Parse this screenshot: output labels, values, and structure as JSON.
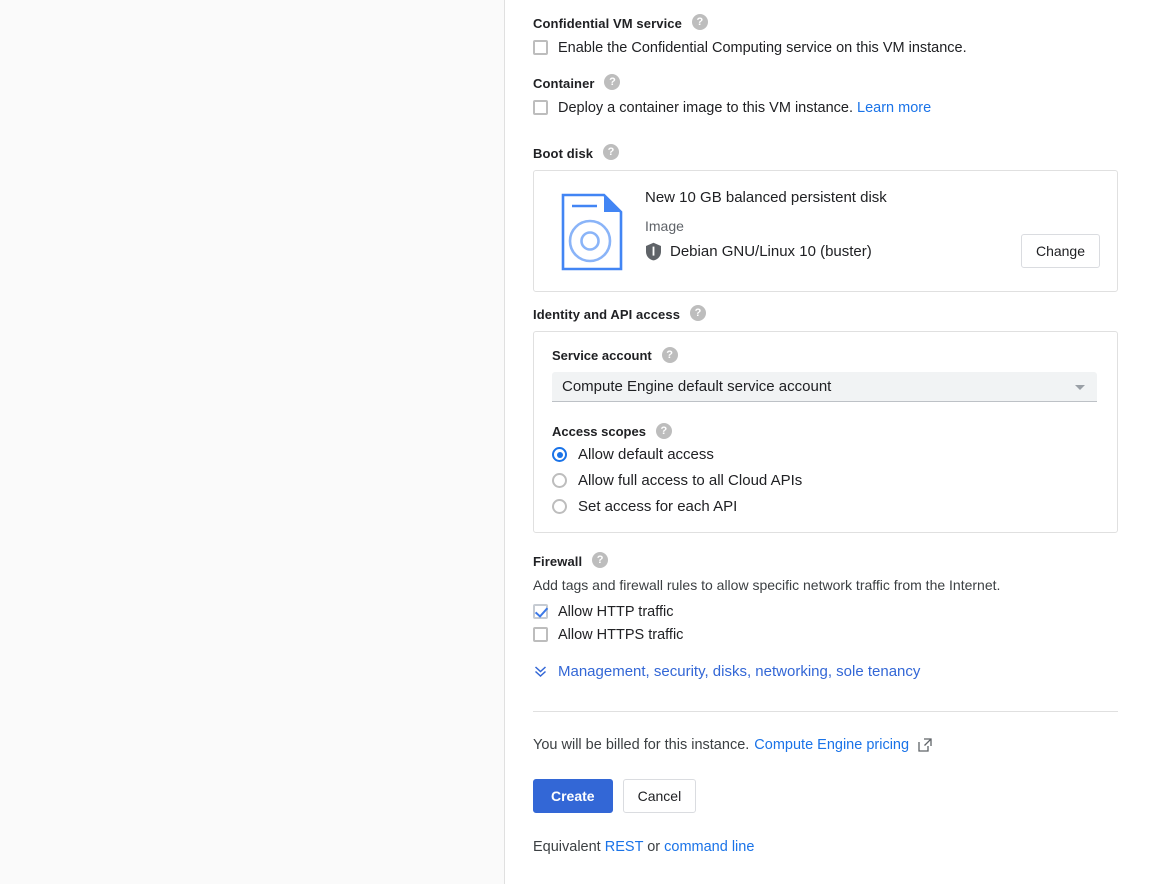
{
  "colors": {
    "accent_blue": "#1a73e8",
    "primary_button": "#3367d6",
    "link": "#3367d6",
    "help_icon_gray": "#bdbdbd",
    "card_border": "#e0e0e0",
    "left_pane": "#fafafa",
    "text": "#202124",
    "muted_text": "#5f6368"
  },
  "confidential_vm": {
    "label": "Confidential VM service",
    "help_icon": "help-circle-icon",
    "checkbox": {
      "label": "Enable the Confidential Computing service on this VM instance.",
      "checked": false
    }
  },
  "container": {
    "label": "Container",
    "help_icon": "help-circle-icon",
    "checkbox": {
      "label": "Deploy a container image to this VM instance.",
      "checked": false
    },
    "learn_more": "Learn more"
  },
  "boot_disk": {
    "label": "Boot disk",
    "help_icon": "help-circle-icon",
    "disk_icon": "disk-image-icon",
    "title": "New 10 GB balanced persistent disk",
    "image_caption": "Image",
    "image_icon": "shield-icon",
    "image_name": "Debian GNU/Linux 10 (buster)",
    "change_button": "Change"
  },
  "identity": {
    "label": "Identity and API access",
    "help_icon": "help-circle-icon",
    "service_account": {
      "label": "Service account",
      "help_icon": "help-circle-icon",
      "value": "Compute Engine default service account",
      "caret_icon": "chevron-down-icon"
    },
    "access_scopes": {
      "label": "Access scopes",
      "help_icon": "help-circle-icon",
      "options": [
        {
          "label": "Allow default access",
          "selected": true
        },
        {
          "label": "Allow full access to all Cloud APIs",
          "selected": false
        },
        {
          "label": "Set access for each API",
          "selected": false
        }
      ]
    }
  },
  "firewall": {
    "label": "Firewall",
    "help_icon": "help-circle-icon",
    "description": "Add tags and firewall rules to allow specific network traffic from the Internet.",
    "options": [
      {
        "label": "Allow HTTP traffic",
        "checked": true
      },
      {
        "label": "Allow HTTPS traffic",
        "checked": false
      }
    ]
  },
  "expander": {
    "icon": "double-chevron-down-icon",
    "label": "Management, security, disks, networking, sole tenancy"
  },
  "footer": {
    "billing_text": "You will be billed for this instance.",
    "pricing_link": "Compute Engine pricing",
    "external_icon": "open-in-new-icon",
    "create_button": "Create",
    "cancel_button": "Cancel",
    "equivalent_prefix": "Equivalent",
    "equivalent_rest": "REST",
    "equivalent_or": "or",
    "equivalent_cli": "command line"
  }
}
